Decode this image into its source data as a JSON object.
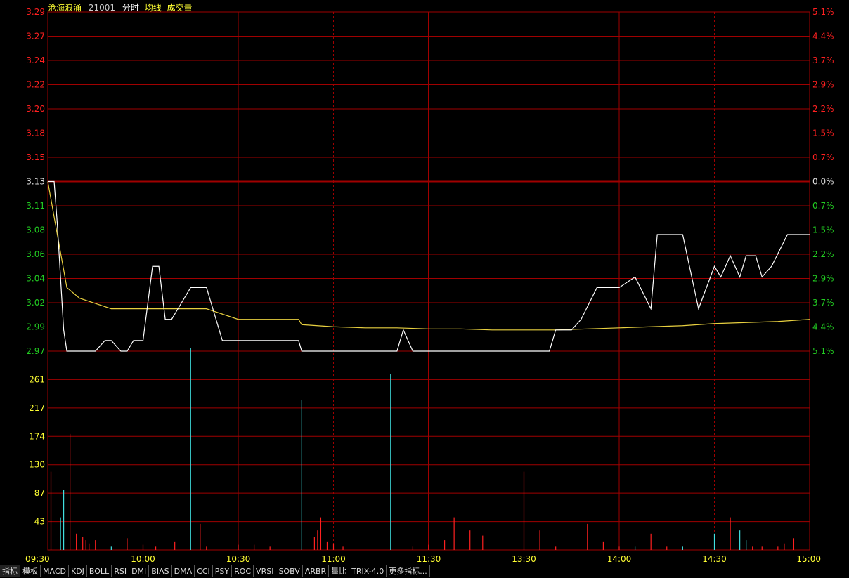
{
  "header": {
    "name": "沧海浪涌",
    "code": "21001",
    "mode": "分时",
    "avg_label": "均线",
    "vol_label": "成交量"
  },
  "colors": {
    "background": "#000000",
    "grid": "#a00000",
    "axis_up": "#ff2020",
    "axis_down": "#22cc22",
    "axis_base": "#dddddd",
    "volume_label": "#ffff33",
    "price_line": "#ffffff",
    "avg_line": "#e8d040",
    "vol_up": "#ff2020",
    "vol_down": "#40e0e0",
    "time_label": "#ffff33"
  },
  "toolbar": {
    "tabs": [
      "指标",
      "模板",
      "MACD",
      "KDJ",
      "BOLL",
      "RSI",
      "DMI",
      "BIAS",
      "DMA",
      "CCI",
      "PSY",
      "ROC",
      "VRSI",
      "SOBV",
      "ARBR",
      "量比",
      "TRIX-4.0",
      "更多指标..."
    ]
  },
  "chart_data": {
    "type": "line",
    "preclose": 3.13,
    "price_ticks": [
      "3.29",
      "3.27",
      "3.24",
      "3.22",
      "3.20",
      "3.18",
      "3.15",
      "3.13",
      "3.11",
      "3.08",
      "3.06",
      "3.04",
      "3.02",
      "2.99",
      "2.97"
    ],
    "pct_ticks": [
      "5.1%",
      "4.4%",
      "3.7%",
      "2.9%",
      "2.2%",
      "1.5%",
      "0.7%",
      "0.0%",
      "0.7%",
      "1.5%",
      "2.2%",
      "2.9%",
      "3.7%",
      "4.4%",
      "5.1%"
    ],
    "ylim": [
      2.97,
      3.29
    ],
    "volume_ticks": [
      "261",
      "217",
      "174",
      "130",
      "87",
      "43"
    ],
    "volume_ylim": [
      0,
      305
    ],
    "time_ticks": [
      "09:30",
      "10:00",
      "10:30",
      "11:00",
      "11:30",
      "13:30",
      "14:00",
      "14:30",
      "15:00"
    ],
    "x_range": [
      0,
      240
    ],
    "price": {
      "x": [
        0,
        2,
        3,
        4,
        5,
        6,
        7,
        8,
        9,
        10,
        11,
        12,
        15,
        18,
        20,
        23,
        25,
        27,
        30,
        33,
        35,
        37,
        39,
        41,
        45,
        50,
        55,
        60,
        63,
        65,
        70,
        75,
        79,
        80,
        85,
        92,
        95,
        100,
        107,
        110,
        112,
        115,
        118,
        120,
        121,
        122,
        125,
        135,
        148,
        158,
        160,
        165,
        168,
        173,
        175,
        180,
        185,
        190,
        192,
        195,
        198,
        200,
        205,
        210,
        212,
        215,
        218,
        220,
        223,
        225,
        228,
        233,
        235,
        240
      ],
      "y": [
        3.13,
        3.13,
        3.09,
        3.04,
        2.99,
        2.97,
        2.97,
        2.97,
        2.97,
        2.97,
        2.97,
        2.97,
        2.97,
        2.98,
        2.98,
        2.97,
        2.97,
        2.98,
        2.98,
        3.05,
        3.05,
        3.0,
        3.0,
        3.01,
        3.03,
        3.03,
        2.98,
        2.98,
        2.98,
        2.98,
        2.98,
        2.98,
        2.98,
        2.97,
        2.97,
        2.97,
        2.97,
        2.97,
        2.97,
        2.97,
        2.99,
        2.97,
        2.97,
        2.97,
        2.97,
        2.97,
        2.97,
        2.97,
        2.97,
        2.97,
        2.99,
        2.99,
        3.0,
        3.03,
        3.03,
        3.03,
        3.04,
        3.01,
        3.08,
        3.08,
        3.08,
        3.08,
        3.01,
        3.05,
        3.04,
        3.06,
        3.04,
        3.06,
        3.06,
        3.04,
        3.05,
        3.08,
        3.08,
        3.08
      ]
    },
    "avg_price": {
      "x": [
        0,
        3,
        6,
        10,
        15,
        20,
        30,
        40,
        45,
        50,
        60,
        70,
        79,
        80,
        90,
        100,
        110,
        120,
        130,
        140,
        150,
        160,
        170,
        180,
        190,
        200,
        210,
        220,
        230,
        240
      ],
      "y": [
        3.13,
        3.08,
        3.03,
        3.02,
        3.015,
        3.01,
        3.01,
        3.01,
        3.01,
        3.01,
        3.0,
        3.0,
        3.0,
        2.995,
        2.993,
        2.992,
        2.992,
        2.991,
        2.991,
        2.99,
        2.99,
        2.99,
        2.991,
        2.992,
        2.993,
        2.994,
        2.996,
        2.997,
        2.998,
        3.0
      ]
    },
    "volume": {
      "x": [
        1,
        4,
        5,
        7,
        9,
        11,
        12,
        13,
        15,
        20,
        25,
        30,
        34,
        40,
        45,
        48,
        50,
        60,
        65,
        70,
        80,
        84,
        85,
        86,
        88,
        90,
        93,
        108,
        115,
        120,
        125,
        128,
        133,
        137,
        150,
        155,
        160,
        170,
        175,
        180,
        185,
        190,
        195,
        200,
        210,
        215,
        218,
        220,
        222,
        225,
        230,
        232,
        235
      ],
      "v": [
        120,
        50,
        92,
        178,
        25,
        20,
        15,
        10,
        15,
        5,
        18,
        8,
        5,
        12,
        310,
        40,
        5,
        8,
        8,
        5,
        230,
        20,
        30,
        50,
        12,
        10,
        5,
        270,
        5,
        8,
        15,
        50,
        30,
        22,
        120,
        30,
        5,
        40,
        12,
        5,
        5,
        25,
        5,
        5,
        25,
        50,
        30,
        15,
        5,
        5,
        5,
        10,
        18
      ],
      "dir": [
        "up",
        "down",
        "down",
        "up",
        "up",
        "up",
        "up",
        "up",
        "up",
        "down",
        "up",
        "up",
        "up",
        "up",
        "down",
        "up",
        "up",
        "up",
        "up",
        "up",
        "down",
        "up",
        "up",
        "up",
        "up",
        "up",
        "up",
        "down",
        "up",
        "up",
        "up",
        "up",
        "up",
        "up",
        "up",
        "up",
        "up",
        "up",
        "up",
        "up",
        "down",
        "up",
        "up",
        "down",
        "down",
        "up",
        "down",
        "down",
        "up",
        "up",
        "up",
        "up",
        "up"
      ]
    }
  }
}
